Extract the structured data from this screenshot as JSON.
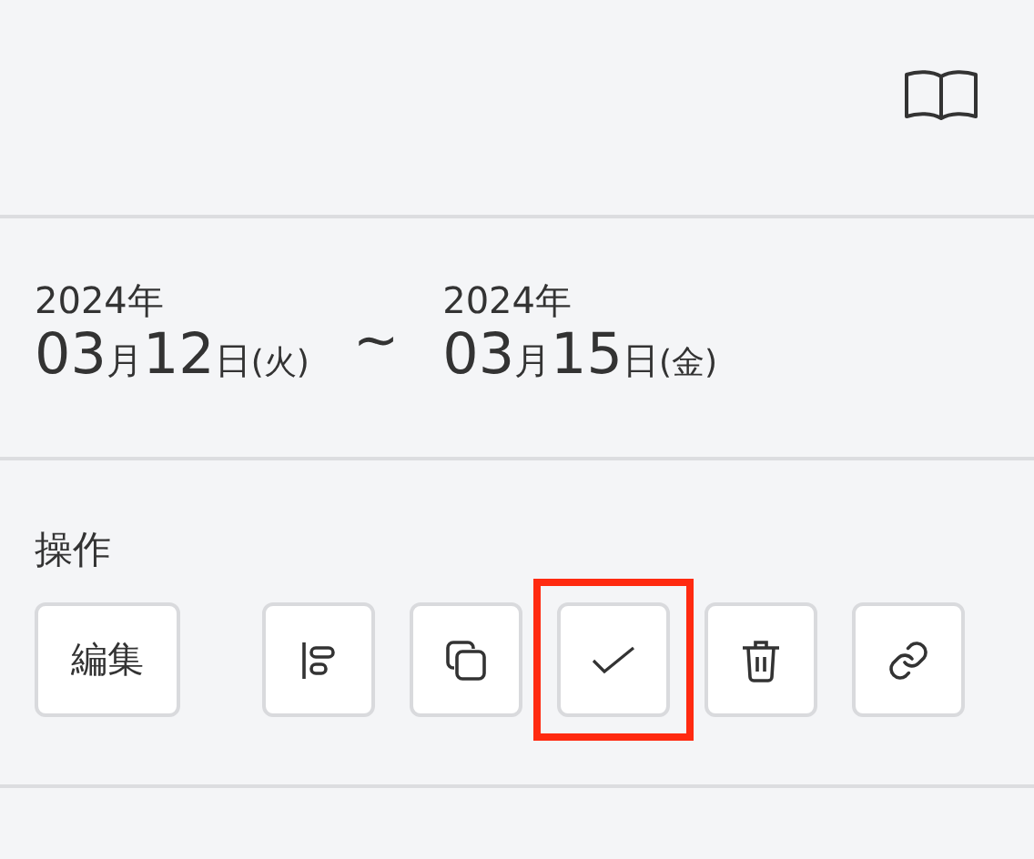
{
  "dates": [
    {
      "year": "2024年",
      "parts": [
        {
          "text": "03",
          "kind": "num"
        },
        {
          "text": "月",
          "kind": "unit"
        },
        {
          "text": "12",
          "kind": "num"
        },
        {
          "text": "日",
          "kind": "unit"
        },
        {
          "text": "(火)",
          "kind": "small"
        }
      ]
    },
    {
      "year": "2024年",
      "parts": [
        {
          "text": "03",
          "kind": "num"
        },
        {
          "text": "月",
          "kind": "unit"
        },
        {
          "text": "15",
          "kind": "num"
        },
        {
          "text": "日",
          "kind": "unit"
        },
        {
          "text": "(金)",
          "kind": "small"
        }
      ]
    }
  ],
  "separator": "~",
  "actions": {
    "title": "操作",
    "edit_label": "編集",
    "buttons": [
      {
        "kind": "align",
        "highlighted": false
      },
      {
        "kind": "copy",
        "highlighted": false
      },
      {
        "kind": "check",
        "highlighted": true
      },
      {
        "kind": "trash",
        "highlighted": false
      },
      {
        "kind": "link",
        "highlighted": false
      }
    ]
  }
}
